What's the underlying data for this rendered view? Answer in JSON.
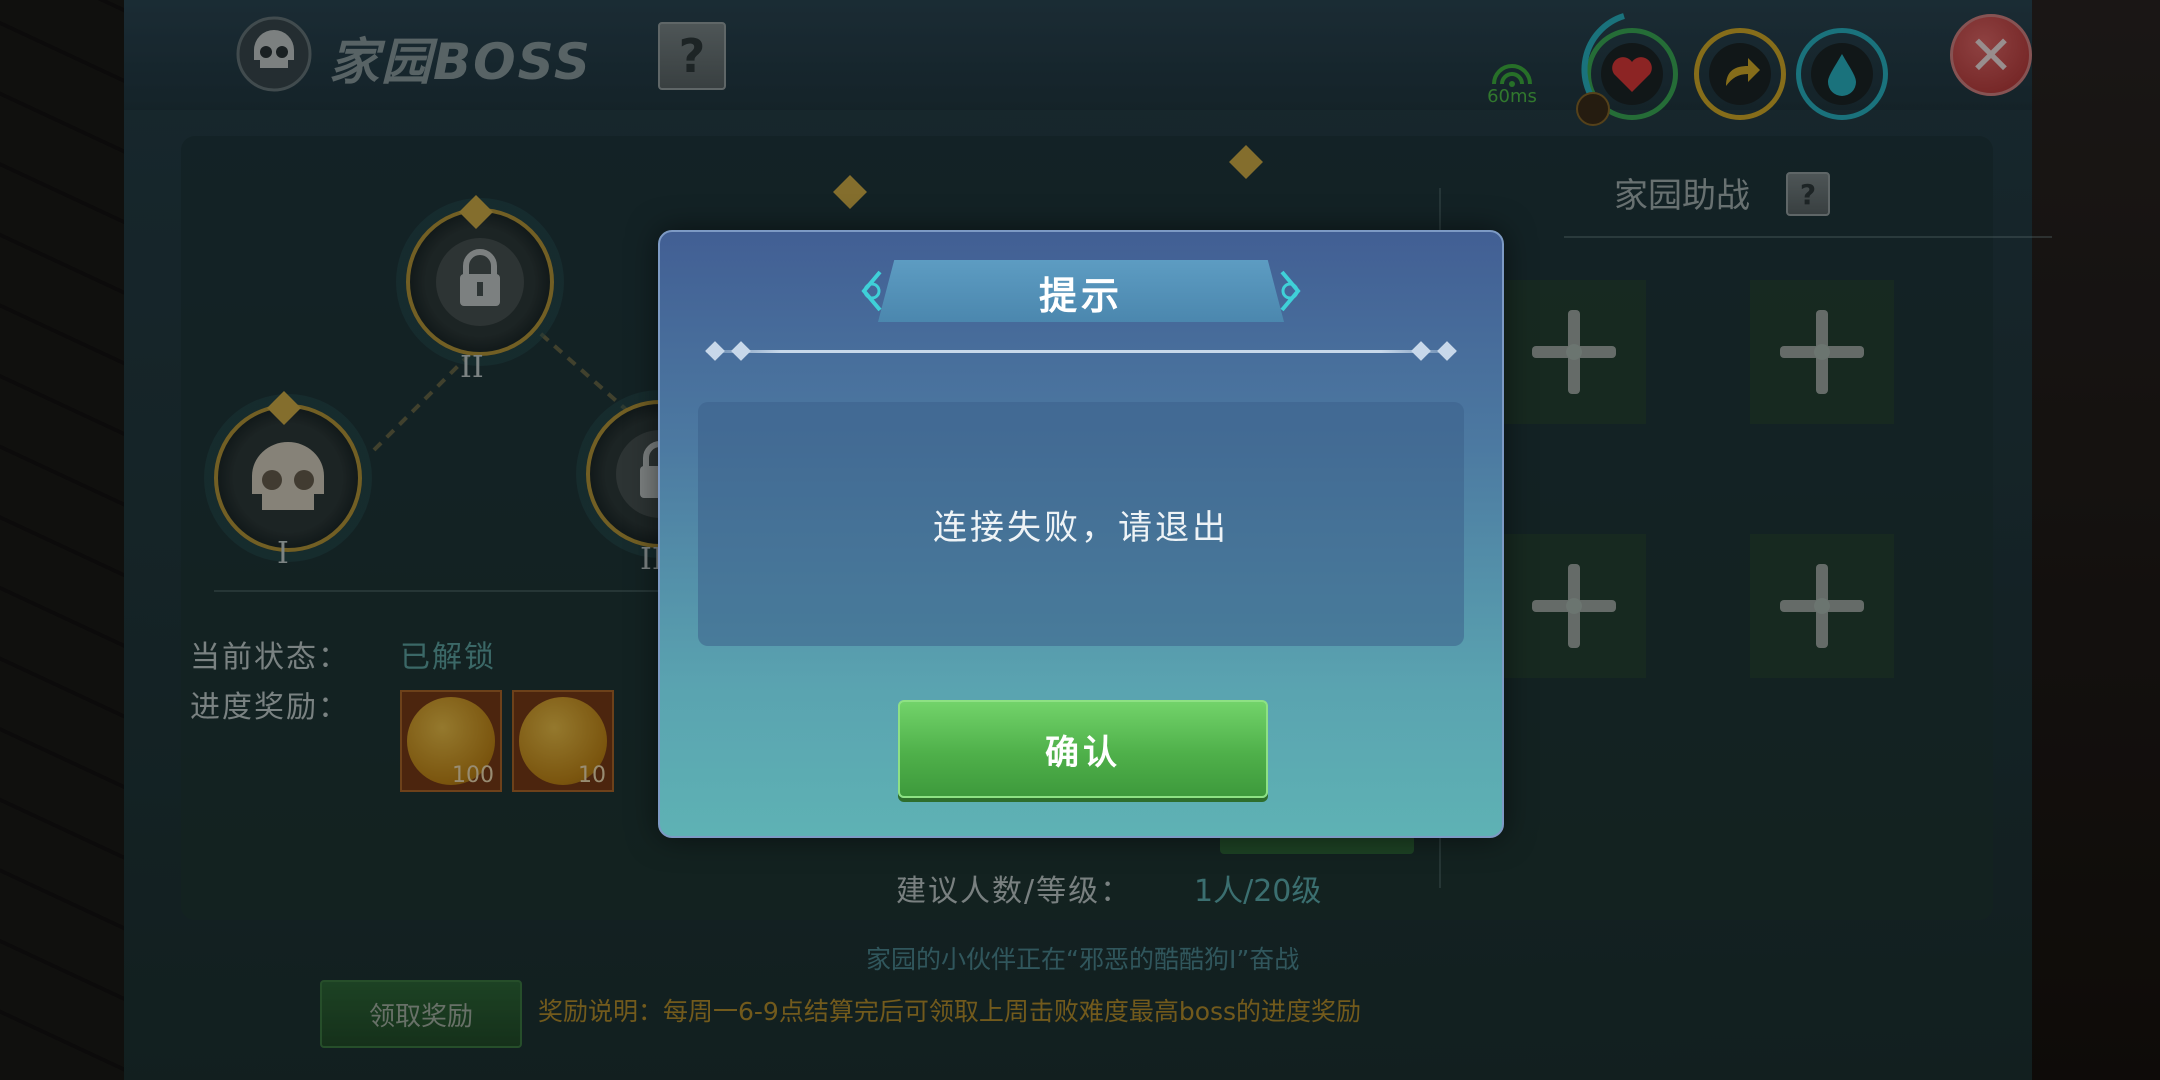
{
  "window": {
    "title": "家园BOSS",
    "help_icon": "?"
  },
  "status_bar": {
    "ping": "60ms",
    "close_icon": "✕"
  },
  "stats": [
    {
      "name": "health",
      "icon": "heart-icon",
      "color": "#e23a3a",
      "ring": "#3db15a"
    },
    {
      "name": "energy",
      "icon": "arrow-icon",
      "color": "#d8b02a",
      "ring": "#d8b02a"
    },
    {
      "name": "water",
      "icon": "drop-icon",
      "color": "#2ab8c8",
      "ring": "#2ab8c8"
    }
  ],
  "boss_path": {
    "nodes": [
      {
        "label": "I",
        "state": "unlocked"
      },
      {
        "label": "II",
        "state": "locked"
      },
      {
        "label": "III",
        "state": "locked"
      }
    ]
  },
  "status": {
    "current_label": "当前状态：",
    "current_value": "已解锁",
    "progress_label": "进度奖励：",
    "rewards": [
      {
        "icon": "gold-coin-icon",
        "count": "100"
      },
      {
        "icon": "gold-coin-icon",
        "count": "10"
      }
    ]
  },
  "support": {
    "title": "家园助战",
    "help_icon": "?",
    "slot_count": 4
  },
  "suggest": {
    "label": "建议人数/等级：",
    "value": "1人/20级"
  },
  "partner_note": "家园的小伙伴正在“邪恶的酷酷狗I”奋战",
  "claim_button": "领取奖励",
  "reward_desc": "奖励说明：每周一6-9点结算完后可领取上周击败难度最高boss的进度奖励",
  "dialog": {
    "title": "提示",
    "message": "连接失败，请退出",
    "confirm": "确认"
  },
  "colors": {
    "accent_teal": "#5fa9a6",
    "reward_gold": "#b8922e",
    "confirm_green": "#4fb04a"
  }
}
